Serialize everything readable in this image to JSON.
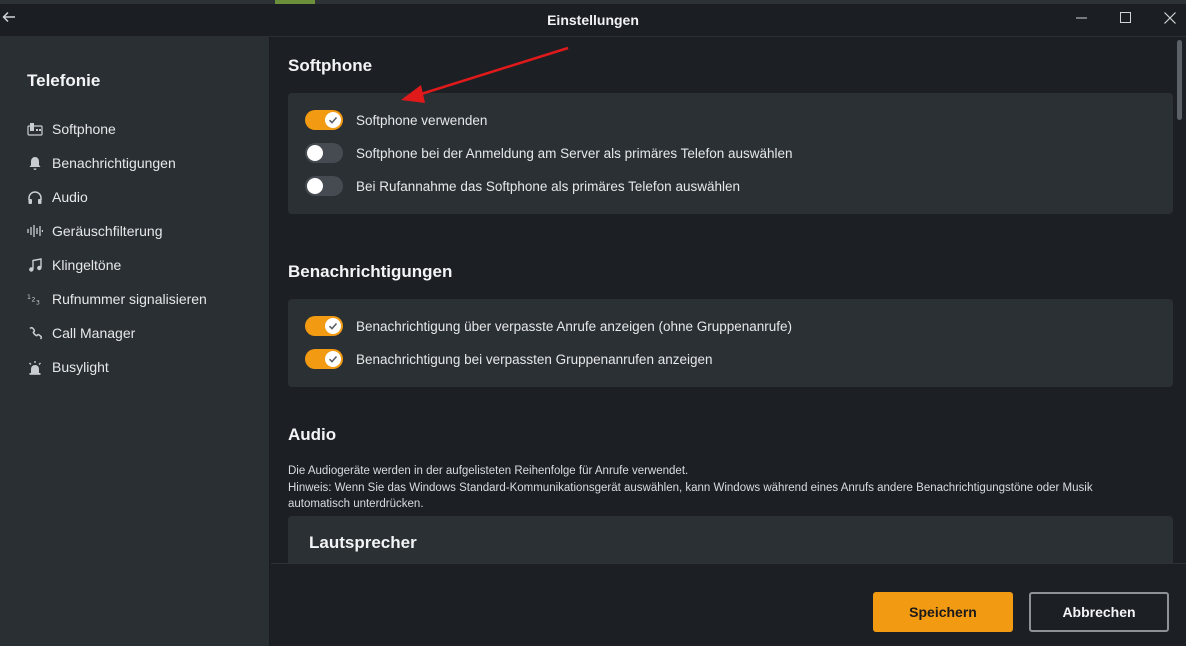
{
  "window": {
    "title": "Einstellungen",
    "back_icon": "arrow-left-icon",
    "controls": [
      "minimize-icon",
      "maximize-icon",
      "close-icon"
    ]
  },
  "sidebar": {
    "title": "Telefonie",
    "items": [
      {
        "label": "Softphone",
        "icon": "softphone-icon"
      },
      {
        "label": "Benachrichtigungen",
        "icon": "bell-icon"
      },
      {
        "label": "Audio",
        "icon": "headphones-icon"
      },
      {
        "label": "Geräuschfilterung",
        "icon": "waveform-icon"
      },
      {
        "label": "Klingeltöne",
        "icon": "music-note-icon"
      },
      {
        "label": "Rufnummer signalisieren",
        "icon": "number-123-icon"
      },
      {
        "label": "Call Manager",
        "icon": "phone-handset-icon"
      },
      {
        "label": "Busylight",
        "icon": "busylight-icon"
      }
    ]
  },
  "softphone": {
    "title": "Softphone",
    "options": [
      {
        "label": "Softphone verwenden",
        "enabled": true
      },
      {
        "label": "Softphone bei der Anmeldung am Server als primäres Telefon auswählen",
        "enabled": false
      },
      {
        "label": "Bei Rufannahme das Softphone als primäres Telefon auswählen",
        "enabled": false
      }
    ]
  },
  "notifications": {
    "title": "Benachrichtigungen",
    "options": [
      {
        "label": "Benachrichtigung über verpasste Anrufe anzeigen (ohne Gruppenanrufe)",
        "enabled": true
      },
      {
        "label": "Benachrichtigung bei verpassten Gruppenanrufen anzeigen",
        "enabled": true
      }
    ]
  },
  "audio": {
    "title": "Audio",
    "description_lines": [
      "Die Audiogeräte werden in der aufgelisteten Reihenfolge für Anrufe verwendet.",
      "Hinweis: Wenn Sie das Windows Standard-Kommunikationsgerät auswählen, kann Windows während eines Anrufs andere Benachrichtigungstöne oder Musik",
      "automatisch unterdrücken."
    ],
    "speaker_title": "Lautsprecher"
  },
  "footer": {
    "save_label": "Speichern",
    "cancel_label": "Abbrechen"
  },
  "colors": {
    "accent": "#f29a11",
    "background": "#1c2024",
    "sidebar": "#2a2f33",
    "card": "#2b3034",
    "annotation_arrow": "#e0191b"
  }
}
